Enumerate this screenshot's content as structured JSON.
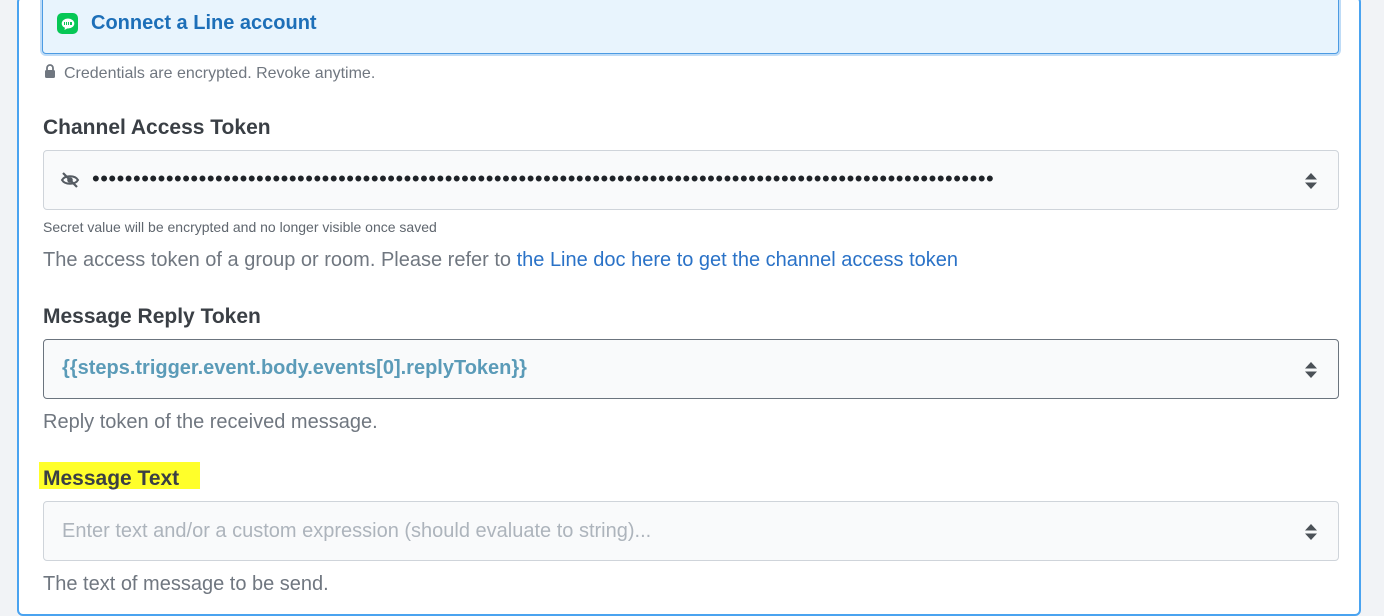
{
  "connect": {
    "label": "Connect a Line account",
    "logo_icon": "line-logo-icon",
    "credentials_note": "Credentials are encrypted. Revoke anytime."
  },
  "fields": {
    "channel_access_token": {
      "label": "Channel Access Token",
      "masked_value": "••••••••••••••••••••••••••••••••••••••••••••••••••••••••••••••••••••••••••••••••••••••••••••••••••••••••••••••",
      "secret_note": "Secret value will be encrypted and no longer visible once saved",
      "help_prefix": "The access token of a group or room. Please refer to ",
      "help_link": "the Line doc here to get the channel access token"
    },
    "message_reply_token": {
      "label": "Message Reply Token",
      "value": "{{steps.trigger.event.body.events[0].replyToken}}",
      "help": "Reply token of the received message."
    },
    "message_text": {
      "label": "Message Text",
      "placeholder": "Enter text and/or a custom expression (should evaluate to string)...",
      "help": "The text of message to be send."
    }
  },
  "colors": {
    "accent": "#4aa3f0",
    "link": "#2a72c7",
    "line_green": "#06c755",
    "highlight": "#ffff2a"
  }
}
